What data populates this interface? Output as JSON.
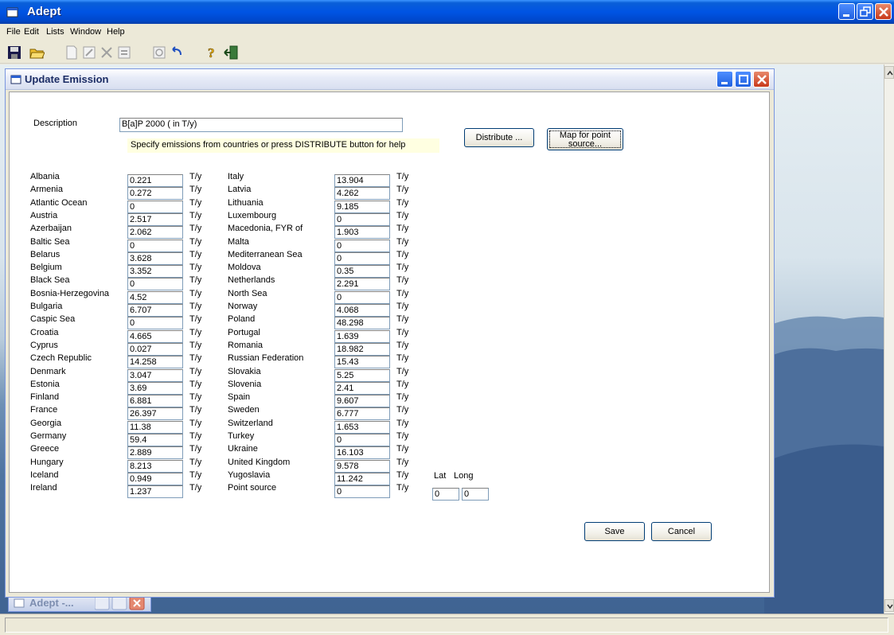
{
  "app": {
    "title": "Adept"
  },
  "menu": [
    {
      "key": "file",
      "label": "File"
    },
    {
      "key": "edit",
      "label": "Edit"
    },
    {
      "key": "lists",
      "label": "Lists"
    },
    {
      "key": "window",
      "label": "Window"
    },
    {
      "key": "help",
      "label": "Help"
    }
  ],
  "toolbar": [
    "save-icon",
    "open-folder-icon",
    "new-document-icon",
    "edit-document-icon",
    "delete-icon",
    "properties-icon",
    "refresh-icon",
    "undo-icon",
    "help-icon",
    "exit-icon"
  ],
  "child": {
    "title": "Update Emission",
    "description_label": "Description",
    "description_value": "B[a]P 2000 ( in T/y)",
    "hint": "Specify emissions from countries or press DISTRIBUTE button for help",
    "distribute_label": "Distribute ...",
    "map_label_line1": "Map for point",
    "map_label_line2": "source...",
    "unit": "T/y",
    "lat_label": "Lat",
    "long_label": "Long",
    "lat_value": "0",
    "long_value": "0",
    "save_label": "Save",
    "cancel_label": "Cancel",
    "left_column": [
      {
        "name": "Albania",
        "value": "0.221"
      },
      {
        "name": "Armenia",
        "value": "0.272"
      },
      {
        "name": "Atlantic Ocean",
        "value": "0"
      },
      {
        "name": "Austria",
        "value": "2.517"
      },
      {
        "name": "Azerbaijan",
        "value": "2.062"
      },
      {
        "name": "Baltic Sea",
        "value": "0"
      },
      {
        "name": "Belarus",
        "value": "3.628"
      },
      {
        "name": "Belgium",
        "value": "3.352"
      },
      {
        "name": "Black Sea",
        "value": "0"
      },
      {
        "name": "Bosnia-Herzegovina",
        "value": "4.52"
      },
      {
        "name": "Bulgaria",
        "value": "6.707"
      },
      {
        "name": "Caspic Sea",
        "value": "0"
      },
      {
        "name": "Croatia",
        "value": "4.665"
      },
      {
        "name": "Cyprus",
        "value": "0.027"
      },
      {
        "name": "Czech Republic",
        "value": "14.258"
      },
      {
        "name": "Denmark",
        "value": "3.047"
      },
      {
        "name": "Estonia",
        "value": "3.69"
      },
      {
        "name": "Finland",
        "value": "6.881"
      },
      {
        "name": "France",
        "value": "26.397"
      },
      {
        "name": "Georgia",
        "value": "11.38"
      },
      {
        "name": "Germany",
        "value": "59.4"
      },
      {
        "name": "Greece",
        "value": "2.889"
      },
      {
        "name": "Hungary",
        "value": "8.213"
      },
      {
        "name": "Iceland",
        "value": "0.949"
      },
      {
        "name": "Ireland",
        "value": "1.237"
      }
    ],
    "right_column": [
      {
        "name": "Italy",
        "value": "13.904"
      },
      {
        "name": "Latvia",
        "value": "4.262"
      },
      {
        "name": "Lithuania",
        "value": "9.185"
      },
      {
        "name": "Luxembourg",
        "value": "0"
      },
      {
        "name": "Macedonia, FYR of",
        "value": "1.903"
      },
      {
        "name": "Malta",
        "value": "0"
      },
      {
        "name": "Mediterranean Sea",
        "value": "0"
      },
      {
        "name": "Moldova",
        "value": "0.35"
      },
      {
        "name": "Netherlands",
        "value": "2.291"
      },
      {
        "name": "North Sea",
        "value": "0"
      },
      {
        "name": "Norway",
        "value": "4.068"
      },
      {
        "name": "Poland",
        "value": "48.298"
      },
      {
        "name": "Portugal",
        "value": "1.639"
      },
      {
        "name": "Romania",
        "value": "18.982"
      },
      {
        "name": "Russian Federation",
        "value": "15.43"
      },
      {
        "name": "Slovakia",
        "value": "5.25"
      },
      {
        "name": "Slovenia",
        "value": "2.41"
      },
      {
        "name": "Spain",
        "value": "9.607"
      },
      {
        "name": "Sweden",
        "value": "6.777"
      },
      {
        "name": "Switzerland",
        "value": "1.653"
      },
      {
        "name": "Turkey",
        "value": "0"
      },
      {
        "name": "Ukraine",
        "value": "16.103"
      },
      {
        "name": "United Kingdom",
        "value": "9.578"
      },
      {
        "name": "Yugoslavia",
        "value": "11.242"
      },
      {
        "name": "Point source",
        "value": "0"
      }
    ]
  },
  "minimized": {
    "title": "Adept -..."
  }
}
